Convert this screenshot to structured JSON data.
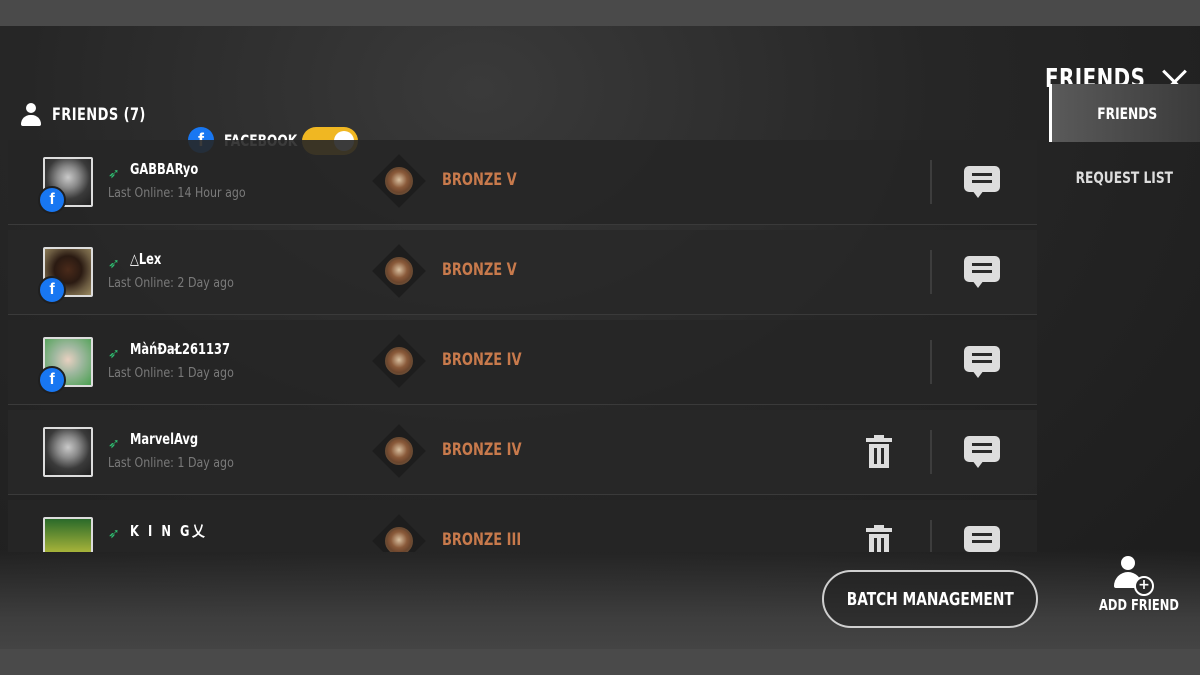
{
  "header": {
    "friends_label": "FRIENDS (7)",
    "facebook_label": "FACEBOOK",
    "facebook_toggle_on": true,
    "toggle_color": "#f0b722"
  },
  "title": "FRIENDS",
  "side_tabs": [
    {
      "label": "FRIENDS",
      "active": true
    },
    {
      "label": "REQUEST LIST",
      "active": false
    }
  ],
  "friends": [
    {
      "name": "GABBARyo",
      "last_online": "Last Online: 14 Hour ago",
      "rank": "BRONZE V",
      "facebook": true,
      "delete": false
    },
    {
      "name": "△Lex",
      "last_online": "Last Online: 2 Day ago",
      "rank": "BRONZE V",
      "facebook": true,
      "delete": false
    },
    {
      "name": "MàńĐaŁ261137",
      "last_online": "Last Online: 1 Day ago",
      "rank": "BRONZE IV",
      "facebook": true,
      "delete": false
    },
    {
      "name": "MarvelAvg",
      "last_online": "Last Online: 1 Day ago",
      "rank": "BRONZE IV",
      "facebook": false,
      "delete": true
    },
    {
      "name": "K I N G乂",
      "last_online": "",
      "rank": "BRONZE III",
      "facebook": false,
      "delete": true
    }
  ],
  "batch_management_label": "BATCH MANAGEMENT",
  "add_friend_label": "ADD FRIEND",
  "rank_color": "#c87a4c",
  "online_color": "#2fbf71"
}
